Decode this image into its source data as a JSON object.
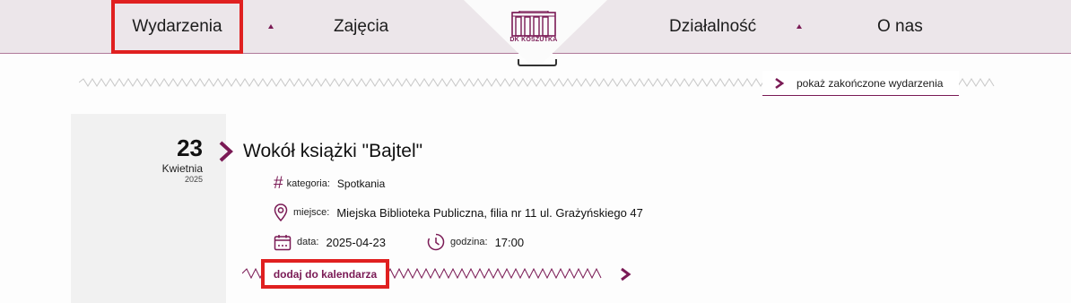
{
  "nav": {
    "items": [
      {
        "label": "Wydarzenia"
      },
      {
        "label": "Zajęcia"
      },
      {
        "label": "Działalność"
      },
      {
        "label": "O nas"
      }
    ],
    "logo_text": "DK KOSZUTKA"
  },
  "toolbar": {
    "show_finished_label": "pokaż zakończone wydarzenia"
  },
  "event": {
    "day": "23",
    "month": "Kwietnia",
    "year": "2025",
    "title": "Wokół książki \"Bajtel\"",
    "category_label": "kategoria:",
    "category_value": "Spotkania",
    "place_label": "miejsce:",
    "place_value": "Miejska Biblioteka Publiczna, filia nr 11 ul. Grażyńskiego 47",
    "date_label": "data:",
    "date_value": "2025-04-23",
    "time_label": "godzina:",
    "time_value": "17:00",
    "add_calendar_label": "dodaj do kalendarza"
  },
  "colors": {
    "accent": "#7a1a55",
    "nav_bg": "#ece6ea",
    "highlight": "#e02020"
  }
}
